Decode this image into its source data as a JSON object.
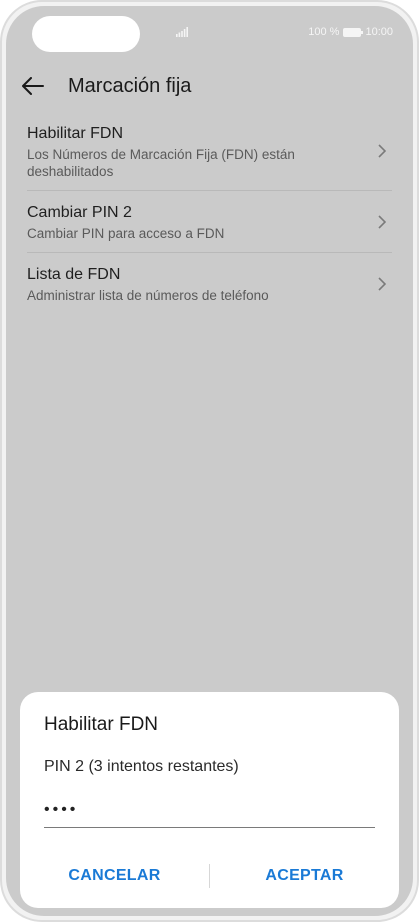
{
  "status_bar": {
    "battery_text": "100 %",
    "time": "10:00"
  },
  "app_bar": {
    "title": "Marcación fija"
  },
  "settings_items": [
    {
      "title": "Habilitar FDN",
      "subtitle": "Los Números de Marcación Fija (FDN) están deshabilitados"
    },
    {
      "title": "Cambiar PIN 2",
      "subtitle": "Cambiar PIN para acceso a FDN"
    },
    {
      "title": "Lista de FDN",
      "subtitle": "Administrar lista de números de teléfono"
    }
  ],
  "dialog": {
    "title": "Habilitar FDN",
    "field_label": "PIN 2 (3 intentos restantes)",
    "field_value": "••••",
    "cancel_label": "CANCELAR",
    "ok_label": "ACEPTAR"
  },
  "colors": {
    "accent": "#1a7ad6",
    "dim_background": "#cbcbcb"
  }
}
